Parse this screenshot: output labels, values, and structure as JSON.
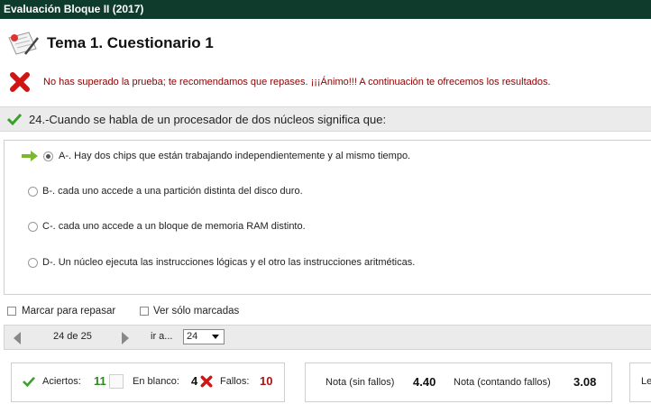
{
  "window": {
    "title": "Evaluación Bloque II (2017)"
  },
  "header": {
    "title": "Tema 1. Cuestionario 1",
    "icon": "quiz-paper-icon"
  },
  "result_message": {
    "icon": "red-x-icon",
    "text": "No has superado la prueba; te recomendamos que repases. ¡¡¡Ánimo!!! A continuación te ofrecemos los resultados."
  },
  "question": {
    "icon": "checkmark-icon",
    "text": "24.-Cuando se habla de un procesador de dos núcleos significa que:"
  },
  "answers": [
    {
      "label": "A-. Hay dos chips que están trabajando independientemente y al mismo tiempo.",
      "selected": true,
      "marker_icon": "right-arrow-icon"
    },
    {
      "label": "B-. cada uno accede a una partición distinta del disco duro.",
      "selected": false
    },
    {
      "label": "C-. cada uno accede a un bloque de memoria RAM distinto.",
      "selected": false
    },
    {
      "label": "D-. Un núcleo ejecuta las instrucciones lógicas y el otro las instrucciones aritméticas.",
      "selected": false
    }
  ],
  "options": {
    "mark_review": "Marcar para repasar",
    "show_marked": "Ver sólo marcadas"
  },
  "navigation": {
    "counter": "24 de 25",
    "goto_label": "ir a...",
    "goto_value": "24"
  },
  "summary": {
    "aciertos_label": "Aciertos:",
    "aciertos_value": "11",
    "blanco_label": "En blanco:",
    "blanco_value": "4",
    "fallos_label": "Fallos:",
    "fallos_value": "10"
  },
  "scores": {
    "sin_fallos_label": "Nota (sin fallos)",
    "sin_fallos_value": "4.40",
    "con_fallos_label": "Nota (contando fallos)",
    "con_fallos_value": "3.08"
  },
  "cut_box": {
    "text": "Le"
  },
  "colors": {
    "topbar": "#0e3b2c",
    "error_text": "#8b0000",
    "correct": "#2a8a1a",
    "wrong": "#a51515"
  }
}
